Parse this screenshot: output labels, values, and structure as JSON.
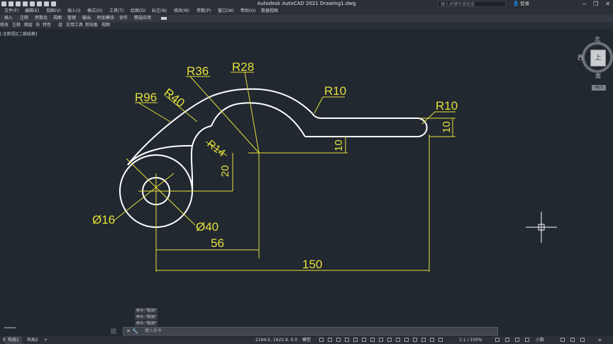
{
  "app": {
    "title": "Autodesk AutoCAD 2021    Drawing1.dwg",
    "search_placeholder": "键入关键字或短语",
    "login": "登录"
  },
  "menu": [
    "文件(F)",
    "编辑(E)",
    "视图(V)",
    "插入(I)",
    "格式(O)",
    "工具(T)",
    "绘图(D)",
    "标注(N)",
    "修改(M)",
    "参数(P)",
    "窗口(W)",
    "帮助(H)",
    "数据视图"
  ],
  "ribbon_tabs": [
    "插入",
    "注释",
    "参数化",
    "视图",
    "管理",
    "输出",
    "附加模块",
    "协作",
    "精选应用"
  ],
  "ribbon_panels": [
    "修改",
    "注释",
    "图层",
    "块",
    "特性",
    "组",
    "实用工具",
    "剪贴板",
    "视图"
  ],
  "view_label": "[-][俯视][二维线框]",
  "viewcube": {
    "north": "北",
    "west": "西",
    "south": "南",
    "face": "上",
    "wcs": "WCS"
  },
  "dimensions": {
    "r36": "R36",
    "r28": "R28",
    "r96": "R96",
    "r40": "R40",
    "r10_top": "R10",
    "r10_right": "R10",
    "r14": "R14",
    "d20": "20",
    "d10_a": "10",
    "d10_b": "10",
    "dia16": "Ø16",
    "dia40": "Ø40",
    "d56": "56",
    "d150": "150"
  },
  "command": {
    "history": [
      "命令: *取消*",
      "命令: *取消*",
      "命令: *取消*"
    ],
    "prompt": "键入命令"
  },
  "layout_tabs": [
    "模型",
    "布局1",
    "布局2",
    "+"
  ],
  "status": {
    "coords": "2194.5, 1622.9, 0.0",
    "model": "模型",
    "scale": "1:1 / 100%",
    "units": "小数"
  },
  "colors": {
    "background": "#212830",
    "geometry": "#ffffff",
    "dimension": "#e6e03a"
  }
}
